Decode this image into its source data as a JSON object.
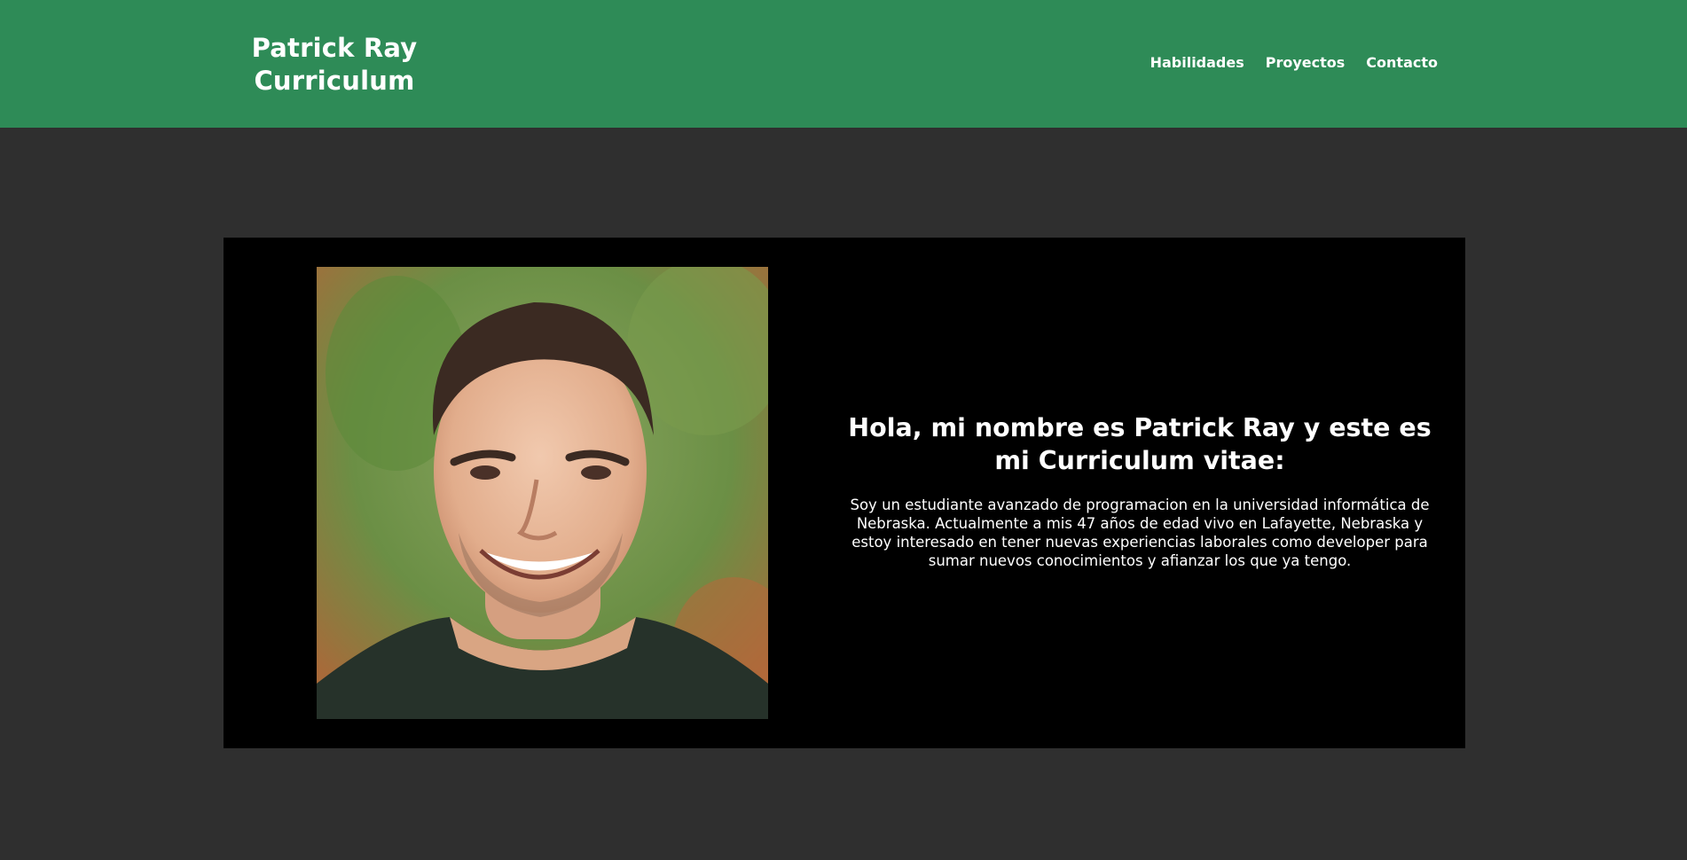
{
  "header": {
    "brand_line1": "Patrick Ray",
    "brand_line2": "Curriculum",
    "nav": [
      {
        "label": "Habilidades"
      },
      {
        "label": "Proyectos"
      },
      {
        "label": "Contacto"
      }
    ]
  },
  "hero": {
    "heading": "Hola, mi nombre es Patrick Ray y este es mi Curriculum vitae:",
    "bio": "Soy un estudiante avanzado de programacion en la universidad informática de Nebraska. Actualmente a mis 47 años de edad vivo en Lafayette, Nebraska y estoy interesado en tener nuevas experiencias laborales como developer para sumar nuevos conocimientos y afianzar los que ya tengo."
  },
  "colors": {
    "header_bg": "#2e8b57",
    "page_bg": "#2f2f2f",
    "hero_bg": "#000000",
    "text": "#ffffff"
  }
}
